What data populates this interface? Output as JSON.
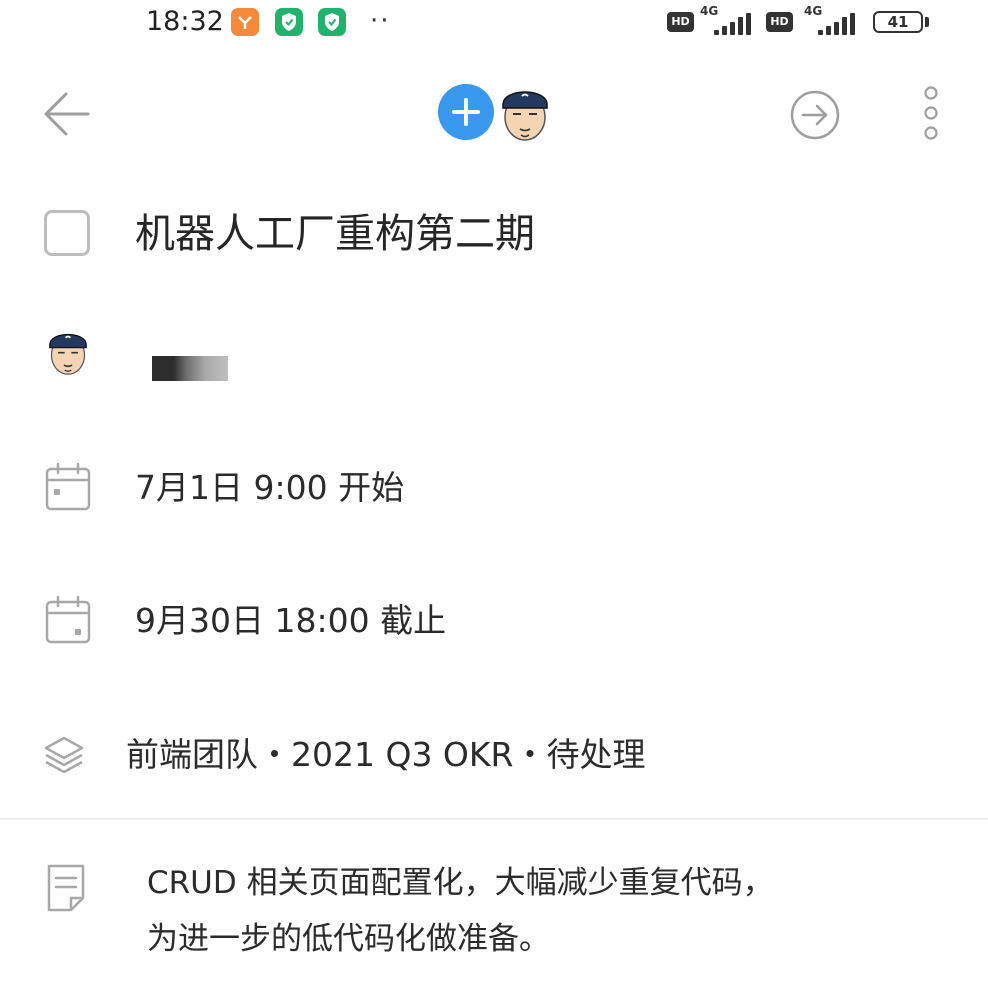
{
  "status_bar": {
    "time": "18:32",
    "dots": "··",
    "sim1": {
      "hd": "HD",
      "network": "4G"
    },
    "sim2": {
      "hd": "HD",
      "network": "4G"
    },
    "battery": "41"
  },
  "colors": {
    "accent": "#3a98ee",
    "icon_gray": "#a8a8a8",
    "text": "#2b2b2b"
  },
  "toolbar": {
    "back_icon": "arrow-left-icon",
    "add_icon": "plus-icon",
    "forward_icon": "arrow-right-circle-icon",
    "more_icon": "more-vertical-icon"
  },
  "task": {
    "title": "机器人工厂重构第二期",
    "completed": false
  },
  "schedule": {
    "start": "7月1日 9:00 开始",
    "due": "9月30日 18:00 截止"
  },
  "project": {
    "label": "前端团队・2021 Q3 OKR・待处理",
    "icon": "layers-icon"
  },
  "note": {
    "line1": "CRUD 相关页面配置化，大幅减少重复代码，",
    "line2": "为进一步的低代码化做准备。",
    "icon": "note-icon"
  }
}
